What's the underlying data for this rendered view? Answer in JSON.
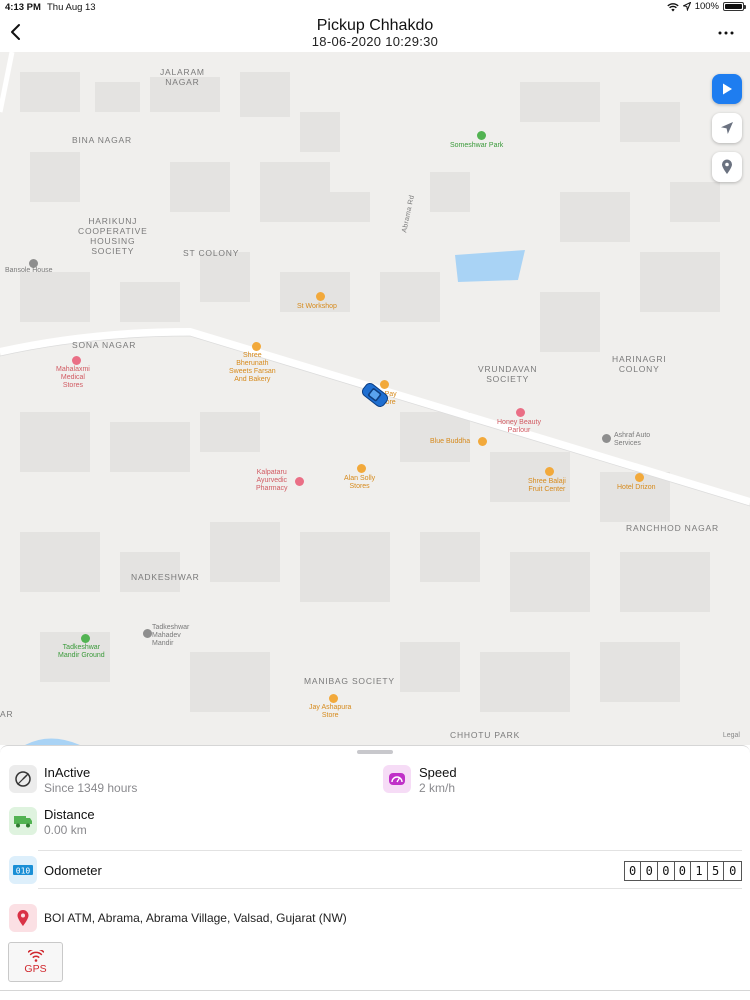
{
  "status_bar": {
    "time": "4:13 PM",
    "date": "Thu Aug 13",
    "battery": "100%"
  },
  "nav": {
    "title": "Pickup Chhakdo",
    "subtitle": "18-06-2020 10:29:30"
  },
  "map": {
    "areas": [
      {
        "id": "jalaram",
        "text": "JALARAM\nNAGAR"
      },
      {
        "id": "bina",
        "text": "BINA NAGAR"
      },
      {
        "id": "harikunj",
        "text": "HARIKUNJ\nCOOPERATIVE\nHOUSING\nSOCIETY"
      },
      {
        "id": "stcolony",
        "text": "ST COLONY"
      },
      {
        "id": "sona",
        "text": "SONA NAGAR"
      },
      {
        "id": "vrundavan",
        "text": "VRUNDAVAN\nSOCIETY"
      },
      {
        "id": "harinagri",
        "text": "HARINAGRI\nCOLONY"
      },
      {
        "id": "ranchhod",
        "text": "RANCHHOD NAGAR"
      },
      {
        "id": "nadkeshwar",
        "text": "NADKESHWAR"
      },
      {
        "id": "manibag",
        "text": "MANIBAG SOCIETY"
      },
      {
        "id": "chhotu",
        "text": "CHHOTU PARK"
      },
      {
        "id": "edge",
        "text": "AR"
      }
    ],
    "pois": [
      {
        "id": "someshwar",
        "text": "Someshwar Park",
        "color": "green"
      },
      {
        "id": "bansole",
        "text": "Bansole House",
        "color": "gray"
      },
      {
        "id": "stworkshop",
        "text": "St Workshop",
        "color": "orange"
      },
      {
        "id": "mahalaxmi",
        "text": "Mahalaxmi\nMedical\nStores",
        "color": "red"
      },
      {
        "id": "shreebherunath",
        "text": "Shree\nBherunath\nSweets Farsan\nAnd Bakery",
        "color": "orange"
      },
      {
        "id": "paystore",
        "text": "& Pay\nStore",
        "color": "orange"
      },
      {
        "id": "honey",
        "text": "Honey Beauty\nParlour",
        "color": "red"
      },
      {
        "id": "bluebuddha",
        "text": "Blue Buddha",
        "color": "orange"
      },
      {
        "id": "ashraf",
        "text": "Ashraf Auto\nServices",
        "color": "gray"
      },
      {
        "id": "kalpataru",
        "text": "Kalpataru\nAyurvedic\nPharmacy",
        "color": "red"
      },
      {
        "id": "alansolly",
        "text": "Alan Solly\nStores",
        "color": "orange"
      },
      {
        "id": "shreebalaji",
        "text": "Shree Balaji\nFruit Center",
        "color": "orange"
      },
      {
        "id": "hoteldrizon",
        "text": "Hotel Drizon",
        "color": "orange"
      },
      {
        "id": "tadkeshwarmahadev",
        "text": "Tadkeshwar\nMahadev\nMandir",
        "color": "gray"
      },
      {
        "id": "tadkeshwarground",
        "text": "Tadkeshwar\nMandir Ground",
        "color": "green"
      },
      {
        "id": "jayashapura",
        "text": "Jay Ashapura\nStore",
        "color": "orange"
      }
    ],
    "road_label": "Abrama Rd",
    "legal": "Legal"
  },
  "panel": {
    "status_title": "InActive",
    "status_sub": "Since 1349 hours",
    "speed_title": "Speed",
    "speed_value": "2 km/h",
    "distance_title": "Distance",
    "distance_value": "0.00 km",
    "odometer_title": "Odometer",
    "odometer_digits": [
      "0",
      "0",
      "0",
      "0",
      "1",
      "5",
      "0"
    ],
    "address": "BOI ATM, Abrama, Abrama Village, Valsad, Gujarat (NW)",
    "gps_label": "GPS"
  },
  "colors": {
    "accent": "#1e7df0",
    "gps_red": "#d0282e",
    "speed_magenta": "#c030c8",
    "distance_green": "#52b352",
    "odometer_blue": "#1a8fd6",
    "location_red": "#d93246",
    "water": "#a9d3f5"
  },
  "icons": {
    "back": "chevron-left-icon",
    "more": "ellipsis-icon",
    "play": "play-icon",
    "locate": "location-arrow-icon",
    "pin": "map-pin-icon",
    "status": "gauge-icon",
    "speed": "speedometer-icon",
    "distance": "truck-icon",
    "odometer": "odometer-icon",
    "address": "location-pin-icon",
    "gps": "wifi-signal-icon",
    "vehicle": "car-icon"
  }
}
